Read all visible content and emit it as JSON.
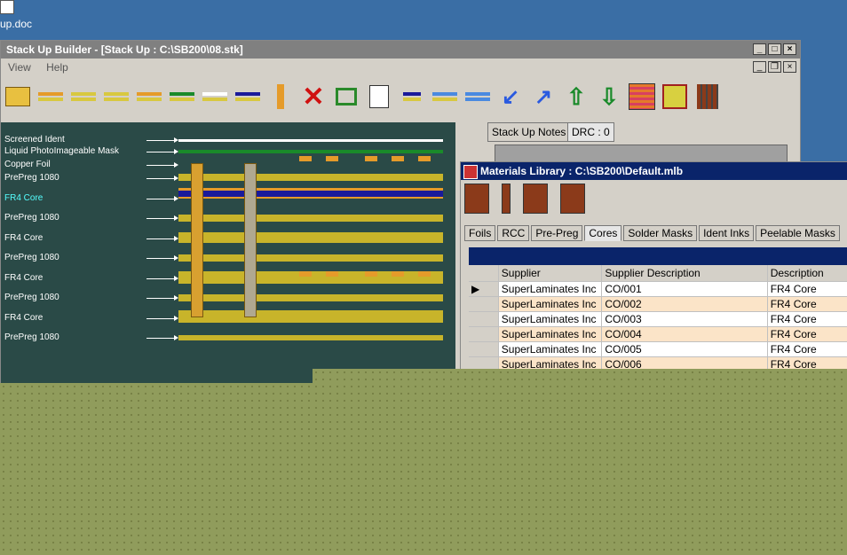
{
  "desktop": {
    "icon_label": "up.doc"
  },
  "main_window": {
    "title": "Stack Up Builder - [Stack Up : C:\\SB200\\08.stk]",
    "menu": [
      "View",
      "Help"
    ],
    "right_tabs": [
      "Stack Up Notes",
      "DRC : 0"
    ]
  },
  "stackup_layers": [
    {
      "label": "Screened Ident",
      "highlight": false
    },
    {
      "label": "Liquid PhotoImageable Mask",
      "highlight": false
    },
    {
      "label": "Copper Foil",
      "highlight": false
    },
    {
      "label": "PrePreg 1080",
      "highlight": false
    },
    {
      "label": "FR4 Core",
      "highlight": true
    },
    {
      "label": "PrePreg 1080",
      "highlight": false
    },
    {
      "label": "FR4 Core",
      "highlight": false
    },
    {
      "label": "PrePreg 1080",
      "highlight": false
    },
    {
      "label": "FR4 Core",
      "highlight": false
    },
    {
      "label": "PrePreg 1080",
      "highlight": false
    },
    {
      "label": "FR4 Core",
      "highlight": false
    },
    {
      "label": "PrePreg 1080",
      "highlight": false
    }
  ],
  "materials_library": {
    "title": "Materials Library : C:\\SB200\\Default.mlb",
    "tabs": [
      "Foils",
      "RCC",
      "Pre-Preg",
      "Cores",
      "Solder Masks",
      "Ident Inks",
      "Peelable Masks"
    ],
    "active_tab": "Cores",
    "columns": [
      "Supplier",
      "Supplier Description",
      "Description"
    ],
    "rows": [
      {
        "supplier": "SuperLaminates Inc",
        "supplier_desc": "CO/001",
        "desc": "FR4 Core",
        "current": true
      },
      {
        "supplier": "SuperLaminates Inc",
        "supplier_desc": "CO/002",
        "desc": "FR4 Core",
        "current": false
      },
      {
        "supplier": "SuperLaminates Inc",
        "supplier_desc": "CO/003",
        "desc": "FR4 Core",
        "current": false
      },
      {
        "supplier": "SuperLaminates Inc",
        "supplier_desc": "CO/004",
        "desc": "FR4 Core",
        "current": false
      },
      {
        "supplier": "SuperLaminates Inc",
        "supplier_desc": "CO/005",
        "desc": "FR4 Core",
        "current": false
      },
      {
        "supplier": "SuperLaminates Inc",
        "supplier_desc": "CO/006",
        "desc": "FR4 Core",
        "current": false
      }
    ],
    "row_pointer": "▶"
  },
  "colors": {
    "canvas": "#2a4a47",
    "prepreg": "#c8b42a",
    "core": "#1a1a9a",
    "copper": "#e59b2a",
    "mask": "#1a8a2a"
  }
}
